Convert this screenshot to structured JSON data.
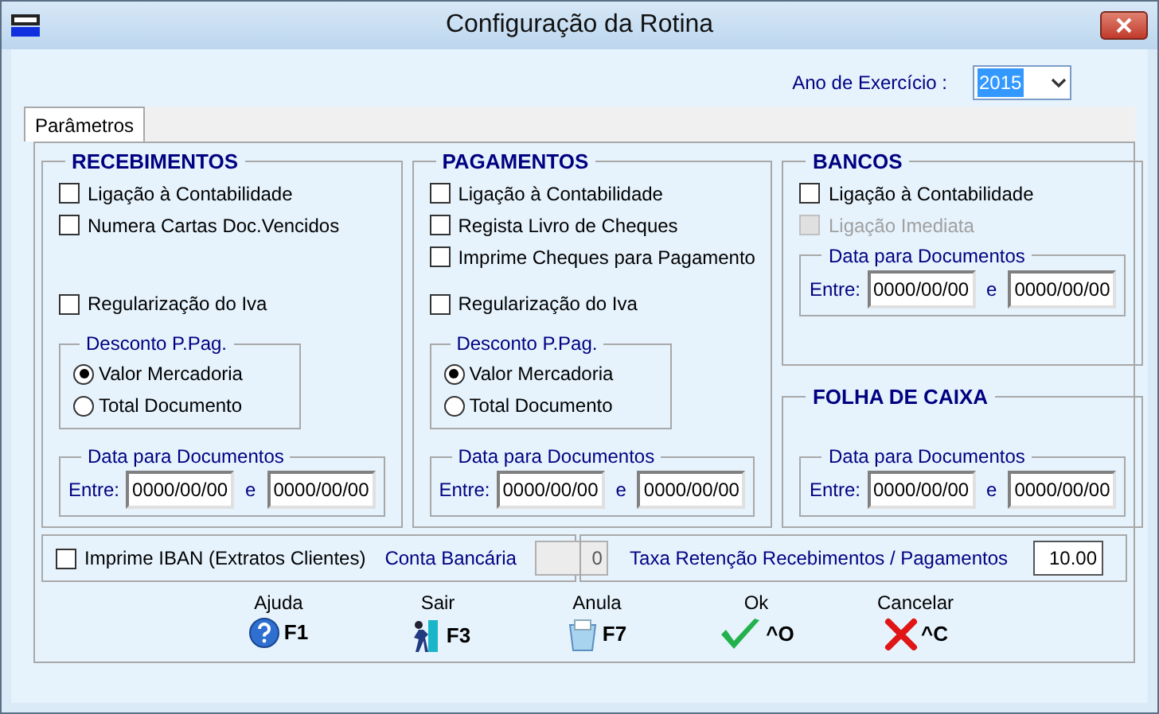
{
  "window": {
    "title": "Configuração da Rotina"
  },
  "year": {
    "label": "Ano de Exercício :",
    "value": "2015"
  },
  "tabs": [
    {
      "label": "Parâmetros",
      "selected": true
    }
  ],
  "sections": [
    {
      "title": "RECEBIMENTOS",
      "checkboxes": [
        {
          "label": "Ligação à Contabilidade",
          "checked": false,
          "disabled": false
        },
        {
          "label": "Numera Cartas Doc.Vencidos",
          "checked": false,
          "disabled": false
        }
      ],
      "lower_checkboxes": [
        {
          "label": "Regularização do Iva",
          "checked": false,
          "disabled": false
        }
      ],
      "discount": {
        "title": "Desconto P.Pag.",
        "options": [
          {
            "label": "Valor Mercadoria",
            "selected": true
          },
          {
            "label": "Total Documento",
            "selected": false
          }
        ]
      },
      "dates": {
        "title": "Data para Documentos",
        "from_label": "Entre:",
        "from": "0000/00/00",
        "and_label": "e",
        "to": "0000/00/00"
      }
    },
    {
      "title": "PAGAMENTOS",
      "checkboxes": [
        {
          "label": "Ligação à Contabilidade",
          "checked": false,
          "disabled": false
        },
        {
          "label": "Regista Livro de Cheques",
          "checked": false,
          "disabled": false
        },
        {
          "label": "Imprime Cheques para Pagamento",
          "checked": false,
          "disabled": false
        }
      ],
      "lower_checkboxes": [
        {
          "label": "Regularização do Iva",
          "checked": false,
          "disabled": false
        }
      ],
      "discount": {
        "title": "Desconto P.Pag.",
        "options": [
          {
            "label": "Valor Mercadoria",
            "selected": true
          },
          {
            "label": "Total Documento",
            "selected": false
          }
        ]
      },
      "dates": {
        "title": "Data para Documentos",
        "from_label": "Entre:",
        "from": "0000/00/00",
        "and_label": "e",
        "to": "0000/00/00"
      }
    },
    {
      "title": "BANCOS",
      "checkboxes": [
        {
          "label": "Ligação à Contabilidade",
          "checked": false,
          "disabled": false
        },
        {
          "label": "Ligação Imediata",
          "checked": false,
          "disabled": true
        }
      ],
      "dates": {
        "title": "Data para Documentos",
        "from_label": "Entre:",
        "from": "0000/00/00",
        "and_label": "e",
        "to": "0000/00/00"
      }
    },
    {
      "title": "FOLHA DE CAIXA",
      "dates": {
        "title": "Data para Documentos",
        "from_label": "Entre:",
        "from": "0000/00/00",
        "and_label": "e",
        "to": "0000/00/00"
      }
    }
  ],
  "iban": {
    "label": "Imprime IBAN (Extratos Clientes)",
    "checked": false
  },
  "account": {
    "label": "Conta Bancária",
    "value": "0",
    "disabled": true
  },
  "rate": {
    "label": "Taxa Retenção Recebimentos / Pagamentos",
    "value": "10.00"
  },
  "buttons": [
    {
      "kind": "help",
      "label": "Ajuda",
      "key": "F1"
    },
    {
      "kind": "exit",
      "label": "Sair",
      "key": "F3"
    },
    {
      "kind": "cancel-doc",
      "label": "Anula",
      "key": "F7"
    },
    {
      "kind": "ok",
      "label": "Ok",
      "key": "^O"
    },
    {
      "kind": "cancel",
      "label": "Cancelar",
      "key": "^C"
    }
  ]
}
